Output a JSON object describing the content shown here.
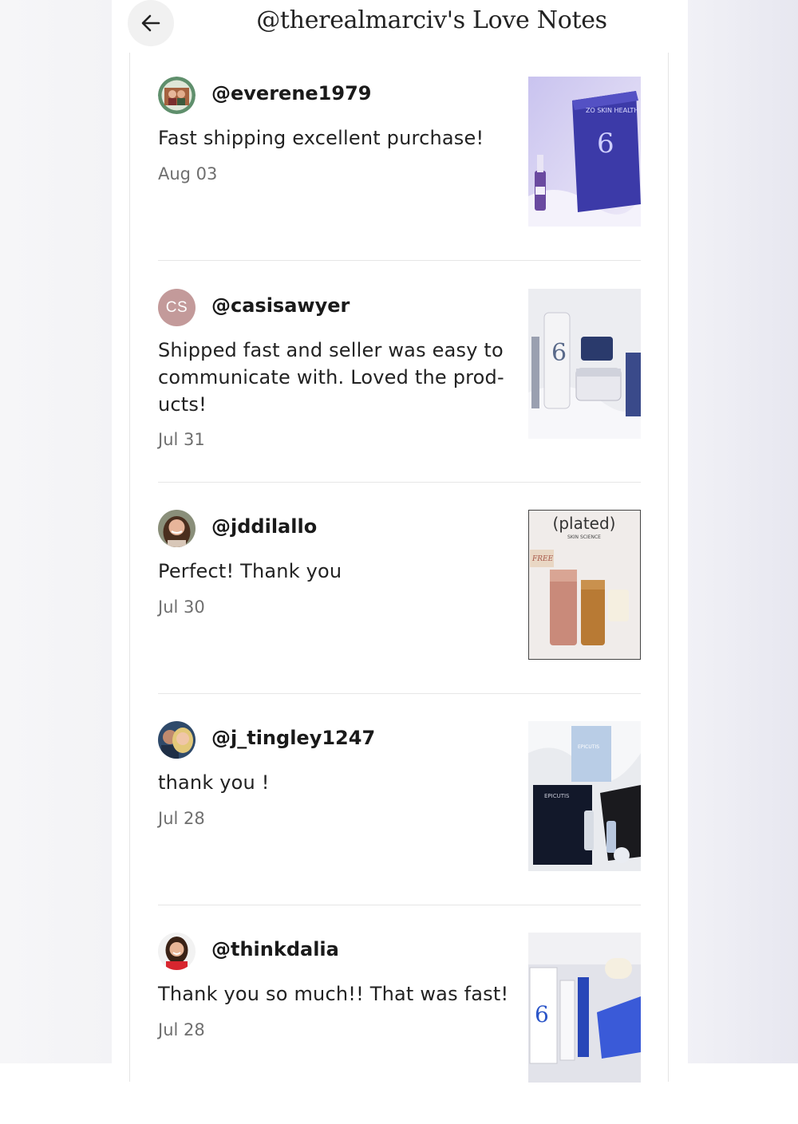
{
  "header": {
    "title": "@therealmarciv's Love Notes",
    "back_icon": "arrow-left-icon"
  },
  "notes": [
    {
      "username": "@everene1979",
      "text": "Fast shipping excellent purchase!",
      "date": "Aug 03",
      "avatar": "photo",
      "photo_label": "ZO SKIN HEALTH"
    },
    {
      "username": "@casisawyer",
      "initials": "CS",
      "text": "Shipped fast and seller was easy to communicate with. Loved the prod-ucts!",
      "date": "Jul 31",
      "avatar": "initials"
    },
    {
      "username": "@jddilallo",
      "text": "Perfect! Thank you",
      "date": "Jul 30",
      "avatar": "photo",
      "photo_label": "(plated)",
      "photo_sublabel": "SKIN SCIENCE"
    },
    {
      "username": "@j_tingley1247",
      "text": "thank you !",
      "date": "Jul 28",
      "avatar": "photo",
      "photo_label": "EPICUTIS"
    },
    {
      "username": "@thinkdalia",
      "text": "Thank you so much!! That was fast!",
      "date": "Jul 28",
      "avatar": "photo"
    }
  ],
  "colors": {
    "initials_avatar": "#c39a9a",
    "divider": "#e6e6e6",
    "date_text": "#6f6f6f"
  }
}
